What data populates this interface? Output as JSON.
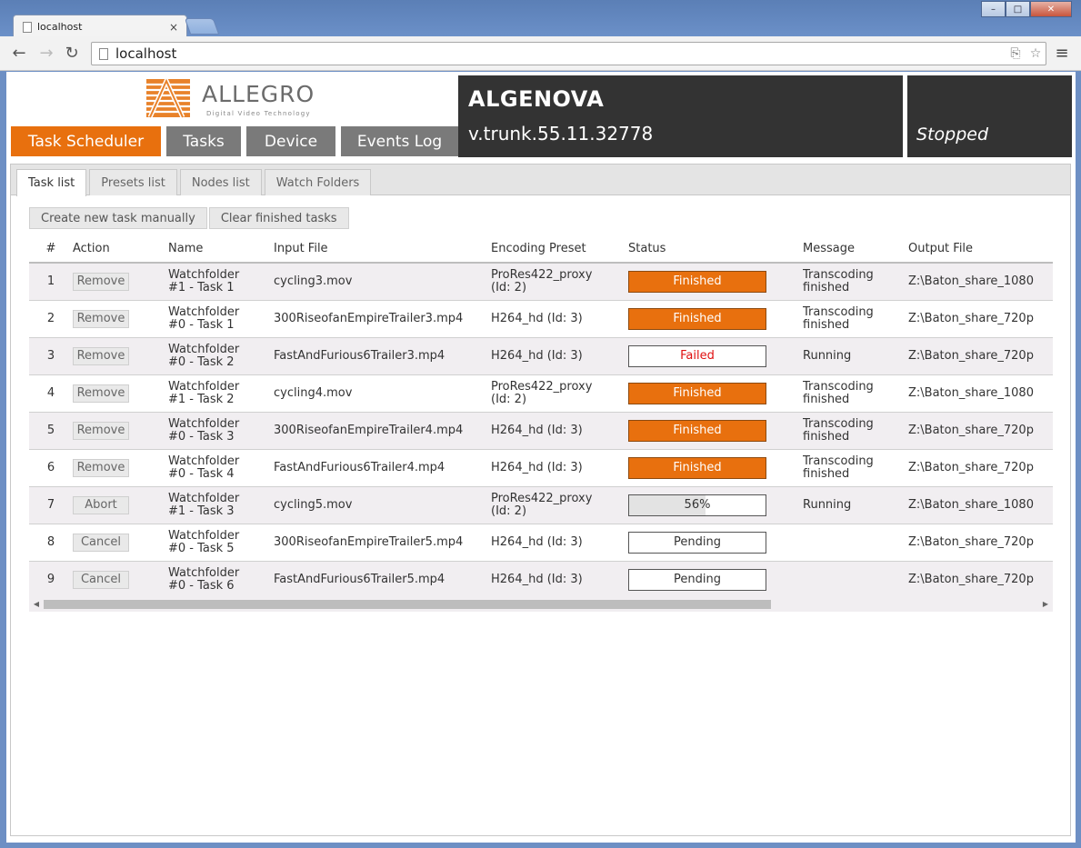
{
  "browser": {
    "tab_title": "localhost",
    "tab_close": "×",
    "url": "localhost",
    "window_controls": [
      "–",
      "□",
      "✕"
    ]
  },
  "header": {
    "logo_text": "ALLEGRO",
    "logo_sub": "Digital Video Technology",
    "app_name": "ALGENOVA",
    "version": "v.trunk.55.11.32778",
    "state": "Stopped"
  },
  "main_tabs": [
    {
      "label": "Task Scheduler",
      "active": true
    },
    {
      "label": "Tasks",
      "active": false
    },
    {
      "label": "Device",
      "active": false
    },
    {
      "label": "Events Log",
      "active": false
    }
  ],
  "sub_tabs": [
    {
      "label": "Task list",
      "active": true
    },
    {
      "label": "Presets list",
      "active": false
    },
    {
      "label": "Nodes list",
      "active": false
    },
    {
      "label": "Watch Folders",
      "active": false
    }
  ],
  "actions": {
    "create": "Create new task manually",
    "clear": "Clear finished tasks"
  },
  "table": {
    "columns": [
      "#",
      "Action",
      "Name",
      "Input File",
      "Encoding Preset",
      "Status",
      "Message",
      "Output File"
    ],
    "rows": [
      {
        "num": "1",
        "action": "Remove",
        "name": [
          "Watchfolder",
          "#1 - Task 1"
        ],
        "input": "cycling3.mov",
        "preset": [
          "ProRes422_proxy",
          "(Id: 2)"
        ],
        "status": "Finished",
        "status_type": "finished",
        "message": [
          "Transcoding",
          "finished"
        ],
        "output": "Z:\\Baton_share_1080"
      },
      {
        "num": "2",
        "action": "Remove",
        "name": [
          "Watchfolder",
          "#0 - Task 1"
        ],
        "input": "300RiseofanEmpireTrailer3.mp4",
        "preset": [
          "H264_hd (Id: 3)"
        ],
        "status": "Finished",
        "status_type": "finished",
        "message": [
          "Transcoding",
          "finished"
        ],
        "output": "Z:\\Baton_share_720p"
      },
      {
        "num": "3",
        "action": "Remove",
        "name": [
          "Watchfolder",
          "#0 - Task 2"
        ],
        "input": "FastAndFurious6Trailer3.mp4",
        "preset": [
          "H264_hd (Id: 3)"
        ],
        "status": "Failed",
        "status_type": "failed",
        "message": [
          "Running"
        ],
        "output": "Z:\\Baton_share_720p"
      },
      {
        "num": "4",
        "action": "Remove",
        "name": [
          "Watchfolder",
          "#1 - Task 2"
        ],
        "input": "cycling4.mov",
        "preset": [
          "ProRes422_proxy",
          "(Id: 2)"
        ],
        "status": "Finished",
        "status_type": "finished",
        "message": [
          "Transcoding",
          "finished"
        ],
        "output": "Z:\\Baton_share_1080"
      },
      {
        "num": "5",
        "action": "Remove",
        "name": [
          "Watchfolder",
          "#0 - Task 3"
        ],
        "input": "300RiseofanEmpireTrailer4.mp4",
        "preset": [
          "H264_hd (Id: 3)"
        ],
        "status": "Finished",
        "status_type": "finished",
        "message": [
          "Transcoding",
          "finished"
        ],
        "output": "Z:\\Baton_share_720p"
      },
      {
        "num": "6",
        "action": "Remove",
        "name": [
          "Watchfolder",
          "#0 - Task 4"
        ],
        "input": "FastAndFurious6Trailer4.mp4",
        "preset": [
          "H264_hd (Id: 3)"
        ],
        "status": "Finished",
        "status_type": "finished",
        "message": [
          "Transcoding",
          "finished"
        ],
        "output": "Z:\\Baton_share_720p"
      },
      {
        "num": "7",
        "action": "Abort",
        "name": [
          "Watchfolder",
          "#1 - Task 3"
        ],
        "input": "cycling5.mov",
        "preset": [
          "ProRes422_proxy",
          "(Id: 2)"
        ],
        "status": "56%",
        "status_type": "progress",
        "progress": 0.56,
        "message": [
          "Running"
        ],
        "output": "Z:\\Baton_share_1080"
      },
      {
        "num": "8",
        "action": "Cancel",
        "name": [
          "Watchfolder",
          "#0 - Task 5"
        ],
        "input": "300RiseofanEmpireTrailer5.mp4",
        "preset": [
          "H264_hd (Id: 3)"
        ],
        "status": "Pending",
        "status_type": "pending",
        "message": [],
        "output": "Z:\\Baton_share_720p"
      },
      {
        "num": "9",
        "action": "Cancel",
        "name": [
          "Watchfolder",
          "#0 - Task 6"
        ],
        "input": "FastAndFurious6Trailer5.mp4",
        "preset": [
          "H264_hd (Id: 3)"
        ],
        "status": "Pending",
        "status_type": "pending",
        "message": [],
        "output": "Z:\\Baton_share_720p"
      }
    ]
  },
  "colors": {
    "accent": "#e8700e",
    "inactive_tab": "#7a7a7a",
    "dark_panel": "#333333",
    "failed_text": "#e01010"
  }
}
